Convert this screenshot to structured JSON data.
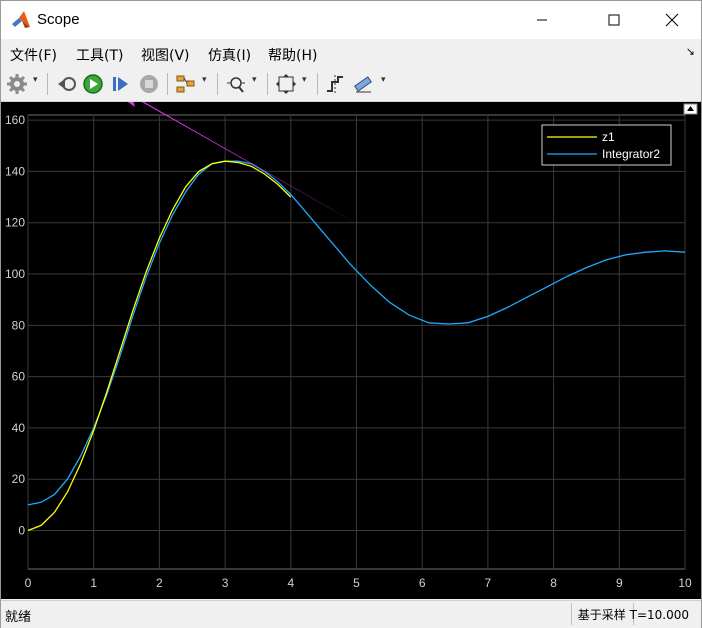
{
  "window": {
    "title": "Scope",
    "minimize_icon": "minimize-icon",
    "maximize_icon": "maximize-icon",
    "close_icon": "close-icon"
  },
  "menu": {
    "items": [
      "文件(F)",
      "工具(T)",
      "视图(V)",
      "仿真(I)",
      "帮助(H)"
    ]
  },
  "toolbar": {
    "icons": [
      "gear-icon",
      "step-back-icon",
      "run-icon",
      "step-forward-icon",
      "stop-icon",
      "signal-select-icon",
      "zoom-icon",
      "autoscale-icon",
      "cursor-measure-icon",
      "measure-icon"
    ]
  },
  "status": {
    "left": "就绪",
    "right": "基于采样  T=10.000"
  },
  "colors": {
    "plot_bg": "#000000",
    "grid": "#3a3a3a",
    "z1": "#ffff00",
    "integrator2": "#1ea9ff",
    "annotation_arrow": "#e83bf2"
  },
  "chart_data": {
    "type": "line",
    "xlim": [
      0,
      10
    ],
    "ylim": [
      -15,
      162
    ],
    "xticks": [
      0,
      1,
      2,
      3,
      4,
      5,
      6,
      7,
      8,
      9,
      10
    ],
    "yticks": [
      0,
      20,
      40,
      60,
      80,
      100,
      120,
      140,
      160
    ],
    "grid": true,
    "legend_position": "top-right",
    "series": [
      {
        "name": "z1",
        "color": "#ffff00",
        "x": [
          0,
          0.2,
          0.4,
          0.6,
          0.8,
          1.0,
          1.2,
          1.4,
          1.6,
          1.8,
          2.0,
          2.2,
          2.4,
          2.6,
          2.8,
          3.0,
          3.2,
          3.4,
          3.6,
          3.8,
          4.0
        ],
        "y": [
          0,
          2,
          7,
          15,
          26,
          39,
          54,
          70,
          86,
          101,
          114,
          125,
          134,
          140,
          143,
          144,
          143.5,
          142,
          139,
          135,
          130
        ]
      },
      {
        "name": "Integrator2",
        "color": "#1ea9ff",
        "x": [
          0,
          0.2,
          0.4,
          0.6,
          0.8,
          1.0,
          1.2,
          1.4,
          1.6,
          1.8,
          2.0,
          2.2,
          2.4,
          2.6,
          2.8,
          3.0,
          3.2,
          3.4,
          3.6,
          3.8,
          4.0,
          4.3,
          4.6,
          4.9,
          5.2,
          5.5,
          5.8,
          6.1,
          6.4,
          6.7,
          7.0,
          7.3,
          7.6,
          7.9,
          8.2,
          8.5,
          8.8,
          9.1,
          9.4,
          9.7,
          10.0
        ],
        "y": [
          10,
          11,
          14,
          20,
          29,
          40,
          53,
          68,
          84,
          99,
          112,
          123,
          132,
          139,
          143,
          144,
          144,
          143,
          140,
          136,
          131,
          122,
          113,
          104,
          96,
          89,
          84,
          81,
          80.5,
          81,
          83.5,
          87,
          91,
          95,
          99,
          102.5,
          105.5,
          107.5,
          108.5,
          109,
          108.5
        ]
      }
    ]
  }
}
